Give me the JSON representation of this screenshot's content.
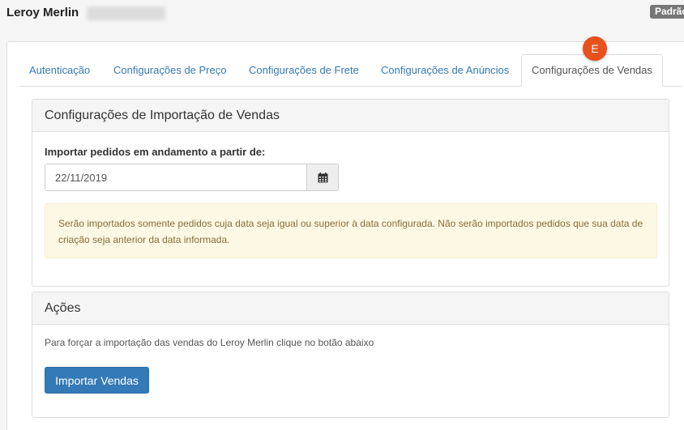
{
  "header": {
    "app_title": "Leroy Merlin",
    "badge": "Padrão"
  },
  "tabs": [
    {
      "label": "Autenticação",
      "active": false
    },
    {
      "label": "Configurações de Preço",
      "active": false
    },
    {
      "label": "Configurações de Frete",
      "active": false
    },
    {
      "label": "Configurações de Anúncios",
      "active": false
    },
    {
      "label": "Configurações de Vendas",
      "active": true
    }
  ],
  "marker": {
    "label": "E",
    "color": "#e8501c"
  },
  "import_section": {
    "title": "Configurações de Importação de Vendas",
    "field_label": "Importar pedidos em andamento a partir de:",
    "date_value": "22/11/2019",
    "calendar_icon": "calendar-icon",
    "alert_text": "Serão importados somente pedidos cuja data seja igual ou superior à data configurada. Não serão importados pedidos que sua data de criação seja anterior da data informada."
  },
  "actions_section": {
    "title": "Ações",
    "description": "Para forçar a importação das vendas do Leroy Merlin clique no botão abaixo",
    "button_label": "Importar Vendas"
  },
  "colors": {
    "primary": "#337ab7",
    "link": "#337ab7",
    "warning_bg": "#fcf8e3",
    "warning_text": "#8a6d3b"
  }
}
